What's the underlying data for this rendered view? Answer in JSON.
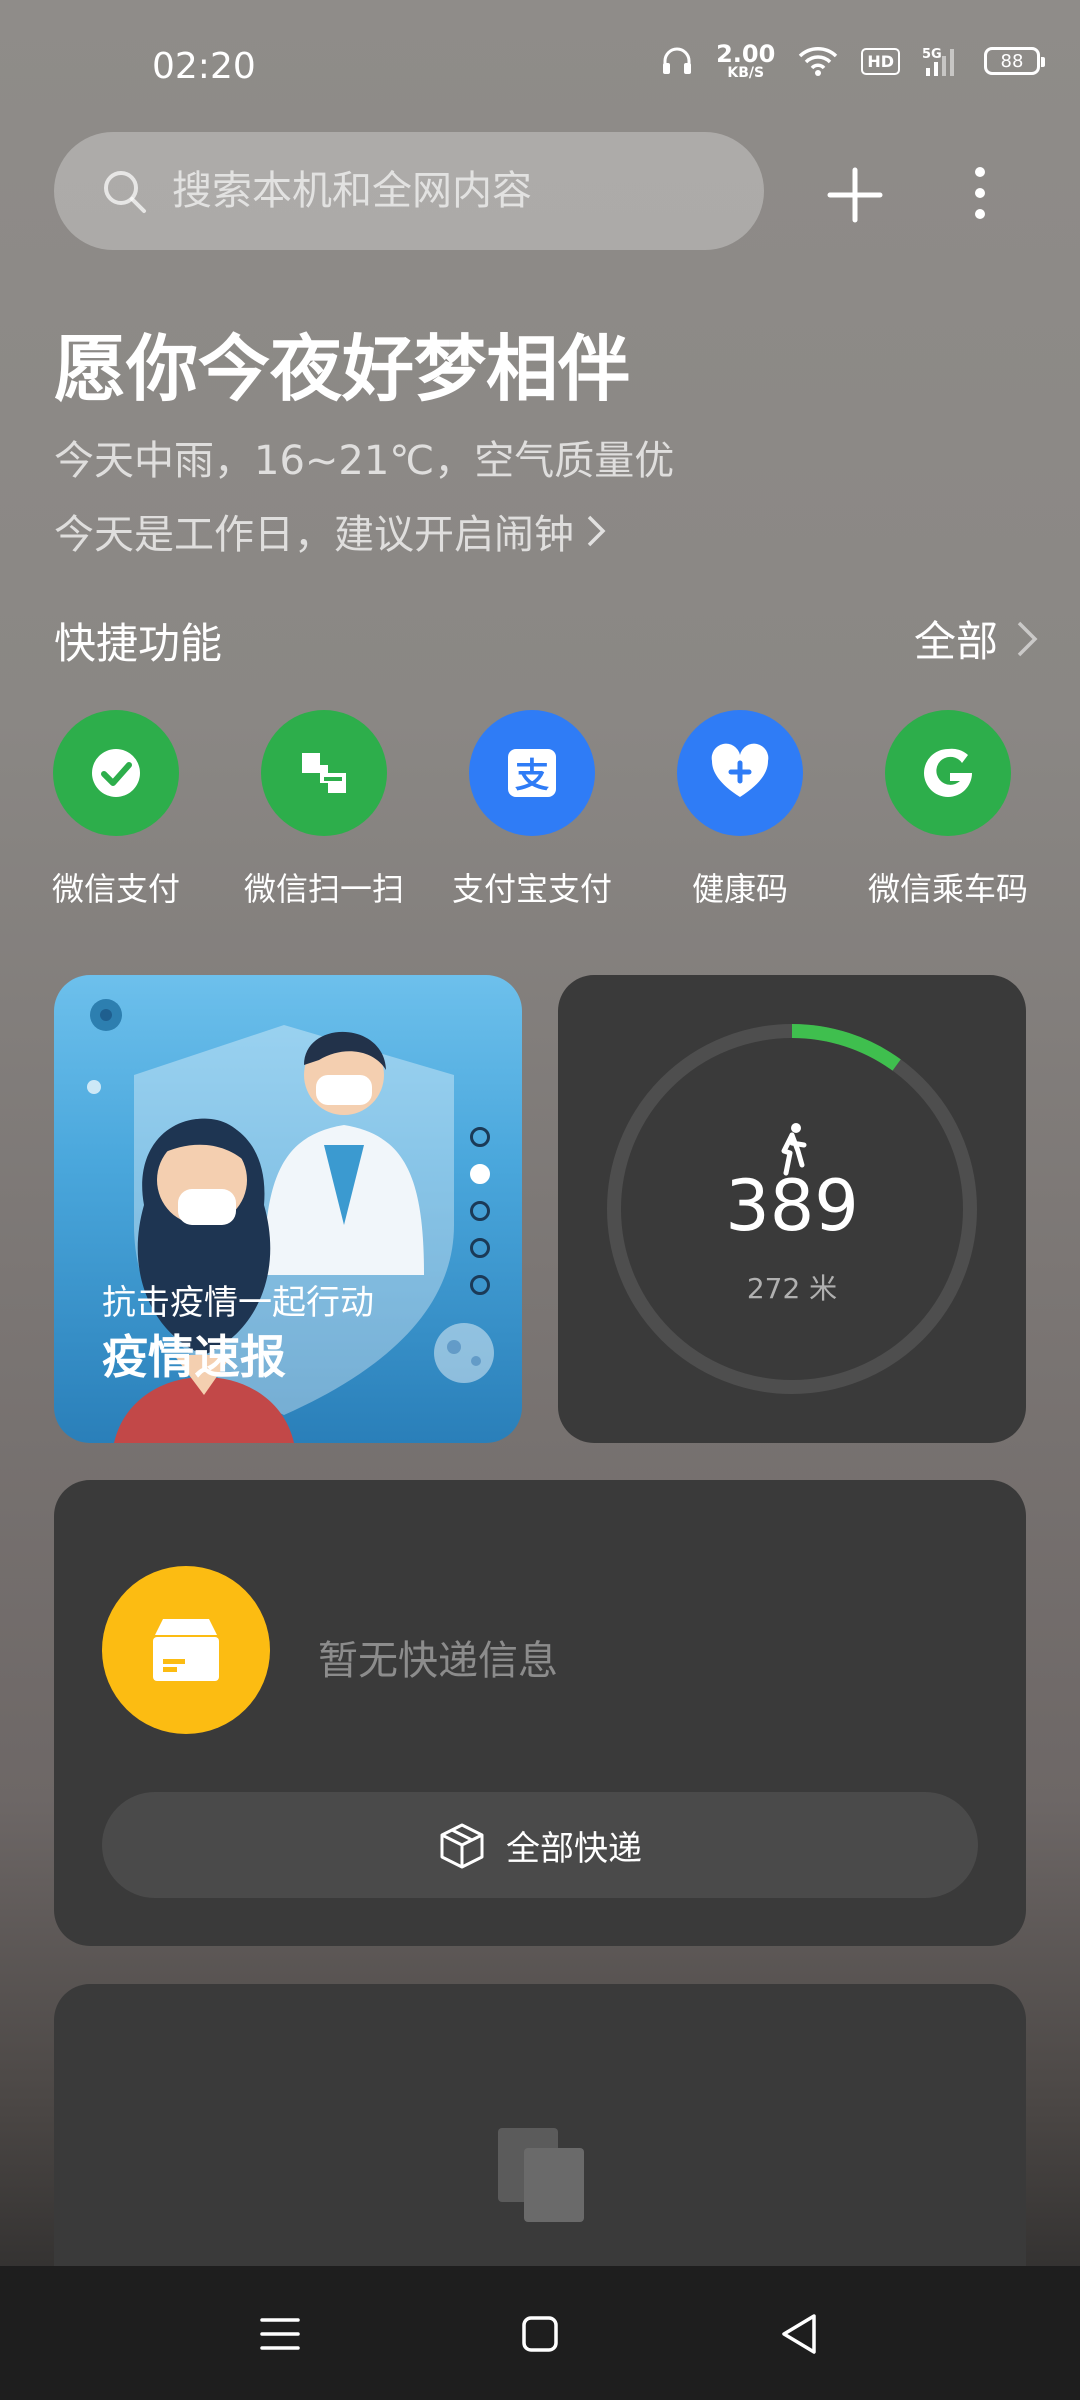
{
  "status": {
    "time": "02:20",
    "net_speed": "2.00",
    "net_unit": "KB/S",
    "hd": "HD",
    "network": "5G",
    "battery": "88"
  },
  "search": {
    "placeholder": "搜索本机和全网内容"
  },
  "greeting": "愿你今夜好梦相伴",
  "weather": "今天中雨，16~21℃，空气质量优",
  "suggestion": "今天是工作日，建议开启闹钟",
  "quick": {
    "title": "快捷功能",
    "all": "全部",
    "items": [
      {
        "label": "微信支付",
        "color": "#2dae4b",
        "icon": "wechat-pay-icon"
      },
      {
        "label": "微信扫一扫",
        "color": "#2dae4b",
        "icon": "wechat-scan-icon"
      },
      {
        "label": "支付宝支付",
        "color": "#2f7cf6",
        "icon": "alipay-icon"
      },
      {
        "label": "健康码",
        "color": "#2f7cf6",
        "icon": "health-code-icon"
      },
      {
        "label": "微信乘车码",
        "color": "#2dae4b",
        "icon": "bus-code-icon"
      }
    ]
  },
  "epidemic": {
    "subtitle": "抗击疫情一起行动",
    "title": "疫情速报",
    "pages": 5,
    "active_page": 2
  },
  "steps": {
    "count": "389",
    "distance": "272 米",
    "progress": 0.1,
    "accent": "#3fbf4e"
  },
  "express": {
    "empty": "暂无快递信息",
    "button": "全部快递",
    "accent": "#fcbc12"
  }
}
